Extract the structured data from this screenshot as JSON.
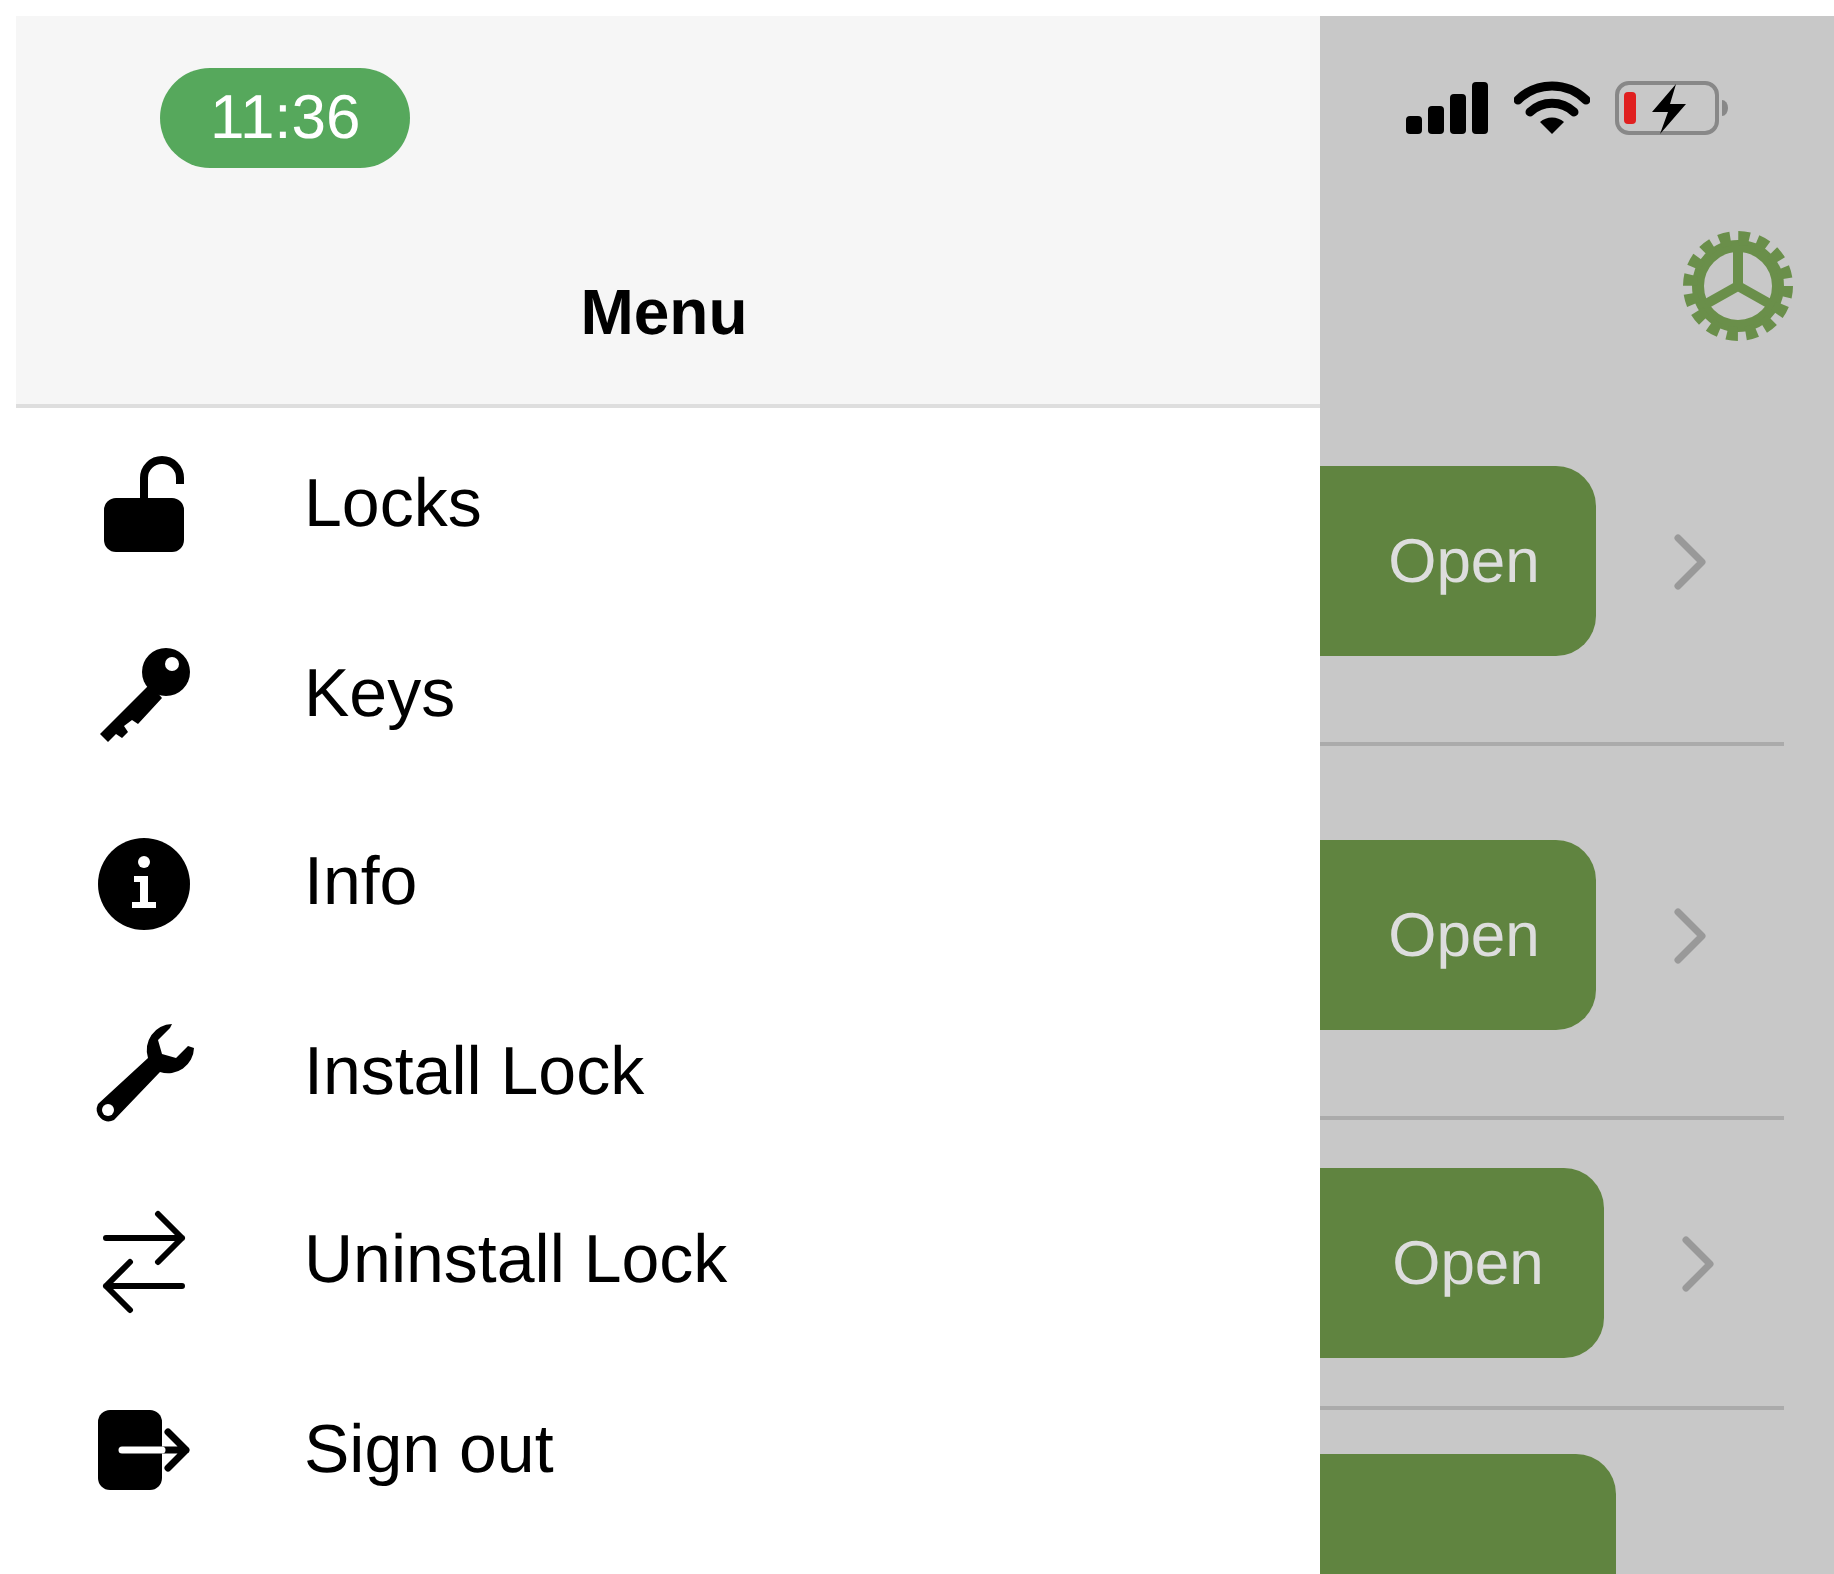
{
  "status_bar": {
    "time": "11:36"
  },
  "menu": {
    "title": "Menu",
    "items": [
      {
        "label": "Locks"
      },
      {
        "label": "Keys"
      },
      {
        "label": "Info"
      },
      {
        "label": "Install Lock"
      },
      {
        "label": "Uninstall Lock"
      },
      {
        "label": "Sign out"
      }
    ]
  },
  "lock_rows": [
    {
      "button": "Open"
    },
    {
      "button": "Open"
    },
    {
      "button": "Open"
    }
  ]
}
